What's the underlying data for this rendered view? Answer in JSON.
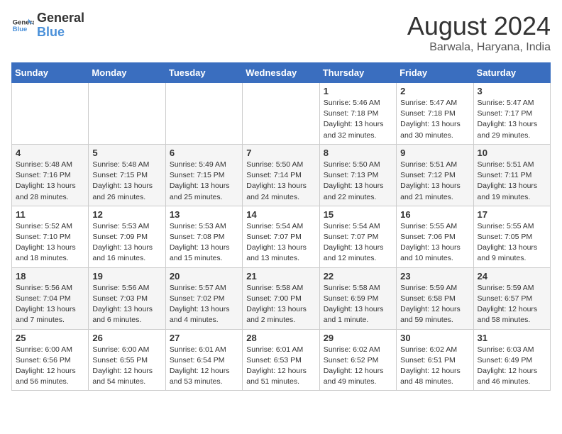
{
  "header": {
    "logo_line1": "General",
    "logo_line2": "Blue",
    "month_year": "August 2024",
    "location": "Barwala, Haryana, India"
  },
  "days_of_week": [
    "Sunday",
    "Monday",
    "Tuesday",
    "Wednesday",
    "Thursday",
    "Friday",
    "Saturday"
  ],
  "weeks": [
    [
      {
        "day": "",
        "info": ""
      },
      {
        "day": "",
        "info": ""
      },
      {
        "day": "",
        "info": ""
      },
      {
        "day": "",
        "info": ""
      },
      {
        "day": "1",
        "info": "Sunrise: 5:46 AM\nSunset: 7:18 PM\nDaylight: 13 hours\nand 32 minutes."
      },
      {
        "day": "2",
        "info": "Sunrise: 5:47 AM\nSunset: 7:18 PM\nDaylight: 13 hours\nand 30 minutes."
      },
      {
        "day": "3",
        "info": "Sunrise: 5:47 AM\nSunset: 7:17 PM\nDaylight: 13 hours\nand 29 minutes."
      }
    ],
    [
      {
        "day": "4",
        "info": "Sunrise: 5:48 AM\nSunset: 7:16 PM\nDaylight: 13 hours\nand 28 minutes."
      },
      {
        "day": "5",
        "info": "Sunrise: 5:48 AM\nSunset: 7:15 PM\nDaylight: 13 hours\nand 26 minutes."
      },
      {
        "day": "6",
        "info": "Sunrise: 5:49 AM\nSunset: 7:15 PM\nDaylight: 13 hours\nand 25 minutes."
      },
      {
        "day": "7",
        "info": "Sunrise: 5:50 AM\nSunset: 7:14 PM\nDaylight: 13 hours\nand 24 minutes."
      },
      {
        "day": "8",
        "info": "Sunrise: 5:50 AM\nSunset: 7:13 PM\nDaylight: 13 hours\nand 22 minutes."
      },
      {
        "day": "9",
        "info": "Sunrise: 5:51 AM\nSunset: 7:12 PM\nDaylight: 13 hours\nand 21 minutes."
      },
      {
        "day": "10",
        "info": "Sunrise: 5:51 AM\nSunset: 7:11 PM\nDaylight: 13 hours\nand 19 minutes."
      }
    ],
    [
      {
        "day": "11",
        "info": "Sunrise: 5:52 AM\nSunset: 7:10 PM\nDaylight: 13 hours\nand 18 minutes."
      },
      {
        "day": "12",
        "info": "Sunrise: 5:53 AM\nSunset: 7:09 PM\nDaylight: 13 hours\nand 16 minutes."
      },
      {
        "day": "13",
        "info": "Sunrise: 5:53 AM\nSunset: 7:08 PM\nDaylight: 13 hours\nand 15 minutes."
      },
      {
        "day": "14",
        "info": "Sunrise: 5:54 AM\nSunset: 7:07 PM\nDaylight: 13 hours\nand 13 minutes."
      },
      {
        "day": "15",
        "info": "Sunrise: 5:54 AM\nSunset: 7:07 PM\nDaylight: 13 hours\nand 12 minutes."
      },
      {
        "day": "16",
        "info": "Sunrise: 5:55 AM\nSunset: 7:06 PM\nDaylight: 13 hours\nand 10 minutes."
      },
      {
        "day": "17",
        "info": "Sunrise: 5:55 AM\nSunset: 7:05 PM\nDaylight: 13 hours\nand 9 minutes."
      }
    ],
    [
      {
        "day": "18",
        "info": "Sunrise: 5:56 AM\nSunset: 7:04 PM\nDaylight: 13 hours\nand 7 minutes."
      },
      {
        "day": "19",
        "info": "Sunrise: 5:56 AM\nSunset: 7:03 PM\nDaylight: 13 hours\nand 6 minutes."
      },
      {
        "day": "20",
        "info": "Sunrise: 5:57 AM\nSunset: 7:02 PM\nDaylight: 13 hours\nand 4 minutes."
      },
      {
        "day": "21",
        "info": "Sunrise: 5:58 AM\nSunset: 7:00 PM\nDaylight: 13 hours\nand 2 minutes."
      },
      {
        "day": "22",
        "info": "Sunrise: 5:58 AM\nSunset: 6:59 PM\nDaylight: 13 hours\nand 1 minute."
      },
      {
        "day": "23",
        "info": "Sunrise: 5:59 AM\nSunset: 6:58 PM\nDaylight: 12 hours\nand 59 minutes."
      },
      {
        "day": "24",
        "info": "Sunrise: 5:59 AM\nSunset: 6:57 PM\nDaylight: 12 hours\nand 58 minutes."
      }
    ],
    [
      {
        "day": "25",
        "info": "Sunrise: 6:00 AM\nSunset: 6:56 PM\nDaylight: 12 hours\nand 56 minutes."
      },
      {
        "day": "26",
        "info": "Sunrise: 6:00 AM\nSunset: 6:55 PM\nDaylight: 12 hours\nand 54 minutes."
      },
      {
        "day": "27",
        "info": "Sunrise: 6:01 AM\nSunset: 6:54 PM\nDaylight: 12 hours\nand 53 minutes."
      },
      {
        "day": "28",
        "info": "Sunrise: 6:01 AM\nSunset: 6:53 PM\nDaylight: 12 hours\nand 51 minutes."
      },
      {
        "day": "29",
        "info": "Sunrise: 6:02 AM\nSunset: 6:52 PM\nDaylight: 12 hours\nand 49 minutes."
      },
      {
        "day": "30",
        "info": "Sunrise: 6:02 AM\nSunset: 6:51 PM\nDaylight: 12 hours\nand 48 minutes."
      },
      {
        "day": "31",
        "info": "Sunrise: 6:03 AM\nSunset: 6:49 PM\nDaylight: 12 hours\nand 46 minutes."
      }
    ]
  ]
}
